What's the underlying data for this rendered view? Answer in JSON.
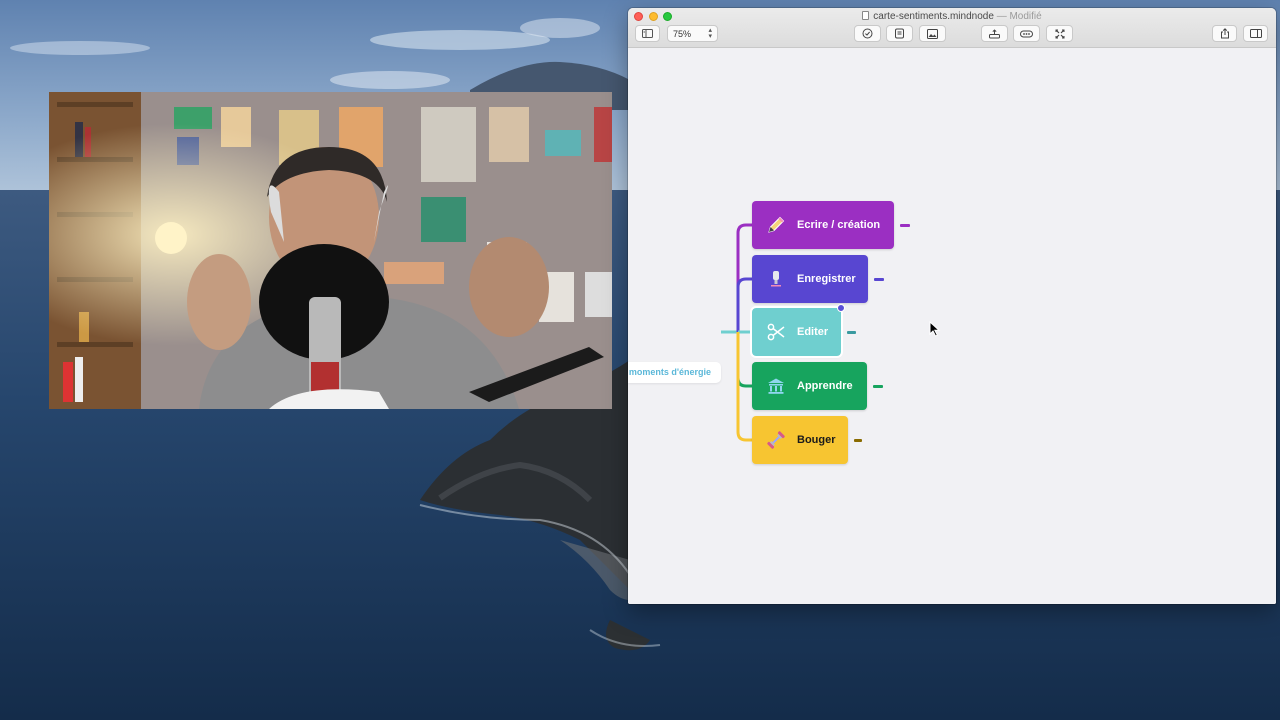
{
  "window": {
    "title": "carte-sentiments.mindnode",
    "modified": "— Modifié",
    "zoom": "75%"
  },
  "toolbar": {
    "left": [
      "sidebar-toggle-icon"
    ],
    "center": [
      "task-check-icon",
      "note-icon",
      "image-icon"
    ],
    "center_right": [
      "add-node-icon",
      "connect-icon",
      "focus-icon"
    ],
    "right": [
      "share-icon",
      "inspector-toggle-icon"
    ]
  },
  "mindmap": {
    "root_label": "moments d'énergie",
    "nodes": [
      {
        "label": "Ecrire / création",
        "color": "#9b2fc2",
        "icon": "pencil-icon"
      },
      {
        "label": "Enregistrer",
        "color": "#5846d1",
        "icon": "microphone-icon"
      },
      {
        "label": "Editer",
        "color": "#6fcfcf",
        "icon": "scissors-icon"
      },
      {
        "label": "Apprendre",
        "color": "#17a45e",
        "icon": "bank-icon"
      },
      {
        "label": "Bouger",
        "color": "#f7c531",
        "icon": "dumbbell-icon"
      }
    ],
    "selected_node": "Editer"
  },
  "webcam": {
    "description_icon": "person-with-microphone"
  },
  "colors": {
    "wallpaper_sky": "#7f9bc0",
    "wallpaper_sea": "#1f3d63",
    "window_bg": "#f1f1f4"
  }
}
